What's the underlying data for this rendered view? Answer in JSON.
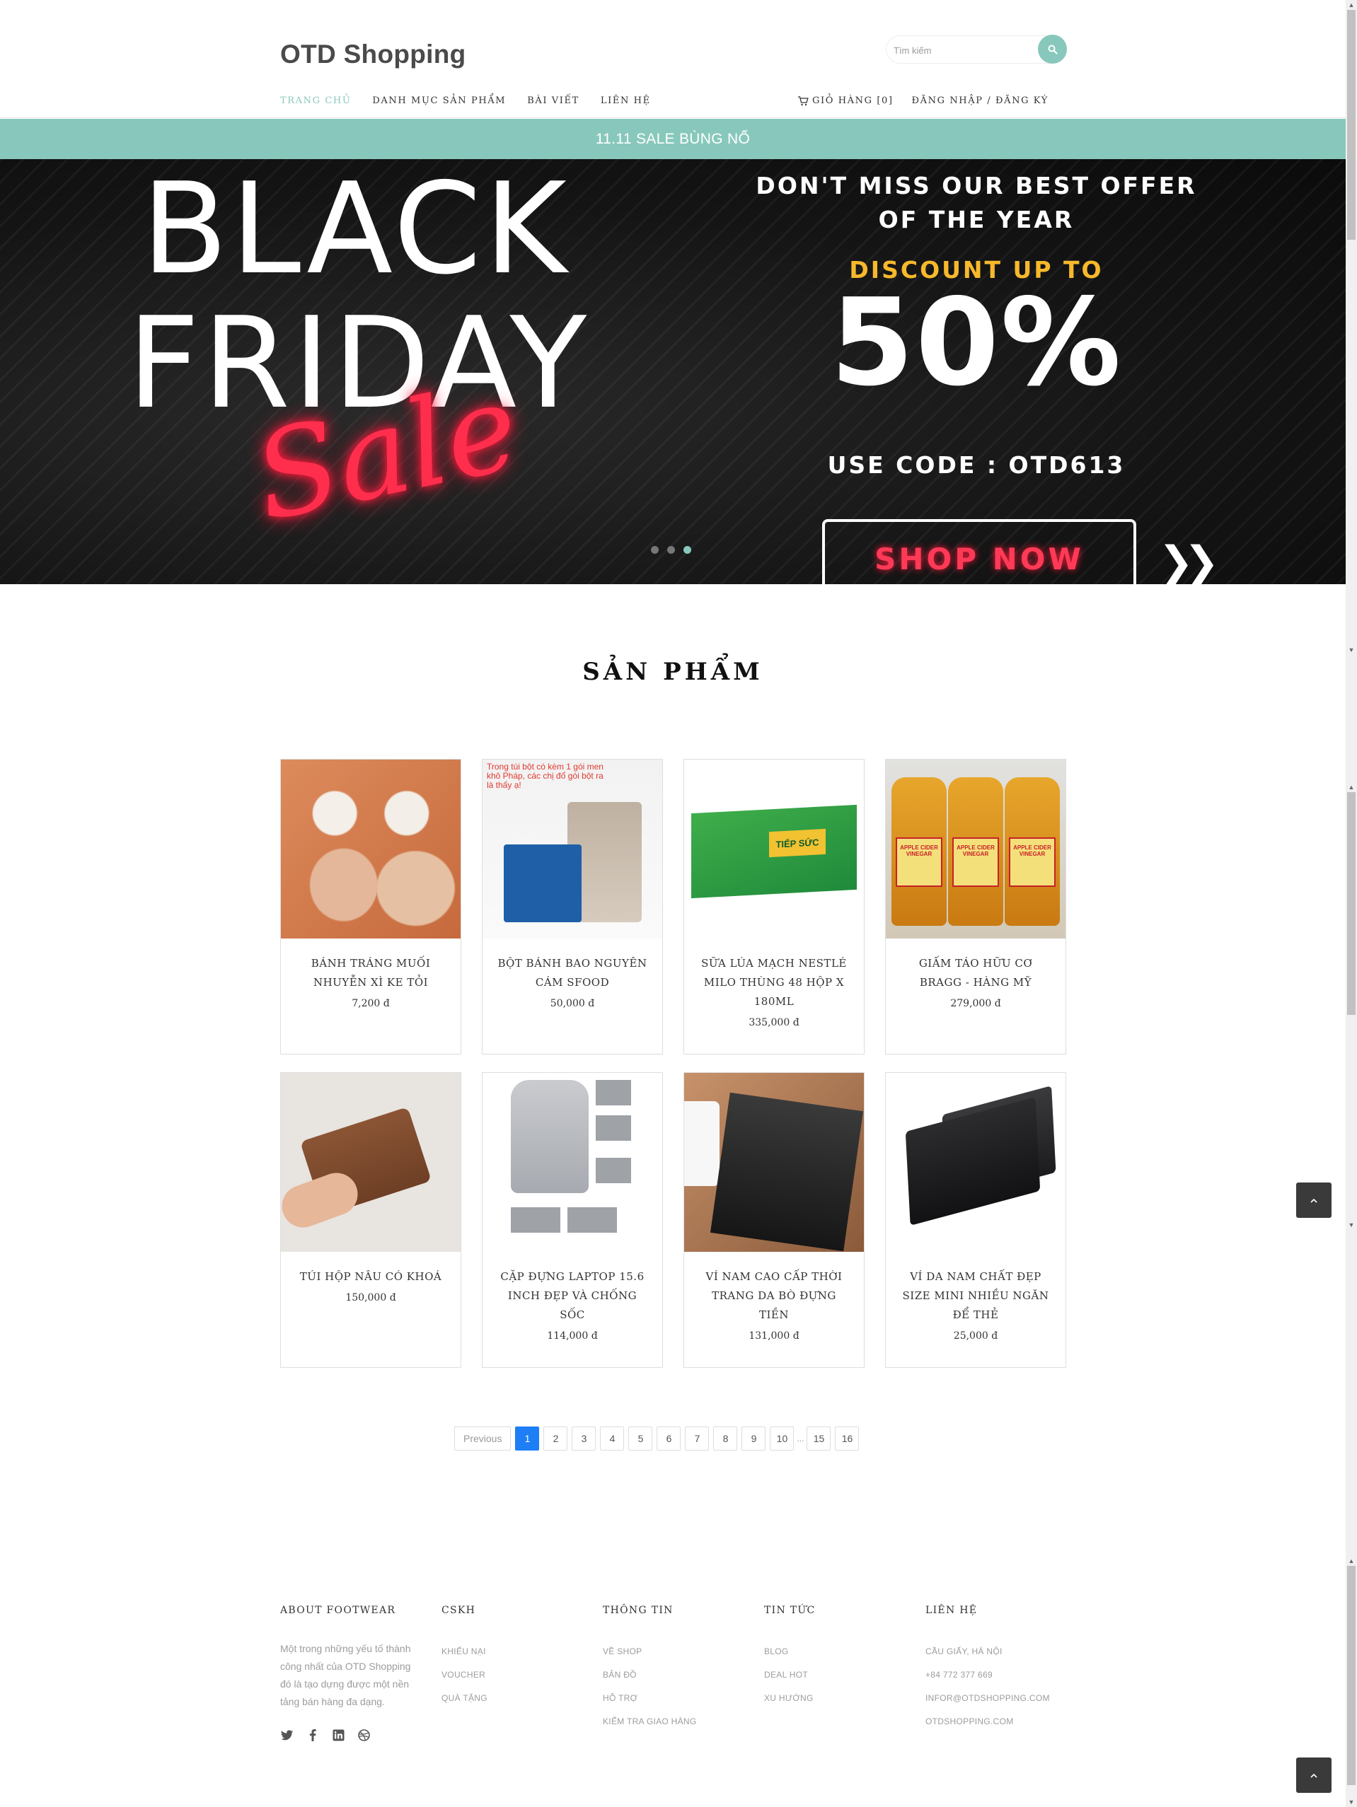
{
  "header": {
    "logo": "OTD Shopping",
    "search_placeholder": "Tìm kiếm",
    "nav": [
      "TRANG CHỦ",
      "DANH MỤC SẢN PHẨM",
      "BÀI VIẾT",
      "LIÊN HỆ"
    ],
    "cart_label": "GIỎ HÀNG [0]",
    "account_label": "ĐĂNG NHẬP / ĐĂNG KÝ"
  },
  "announcement": "11.11 SALE BÙNG NỔ",
  "banner": {
    "line1": "BLACK",
    "line2": "FRIDAY",
    "script": "Sale",
    "offer": "DON'T MISS OUR BEST OFFER OF THE YEAR",
    "discount": "DISCOUNT UP TO",
    "percent": "50%",
    "code": "USE CODE : OTD613",
    "cta": "SHOP NOW",
    "slides_total": 3,
    "slide_active": 3
  },
  "products_section": {
    "title": "SẢN PHẨM",
    "items": [
      {
        "name": "BÁNH TRÁNG MUỐI NHUYỄN XÌ KE TỎI",
        "price": "7,200 đ"
      },
      {
        "name": "BỘT BÁNH BAO NGUYÊN CÁM SFOOD",
        "price": "50,000 đ",
        "image_text": "Trong túi bột có kèm 1 gói men khô Pháp, các chị đổ gói bột ra là thấy ạ!"
      },
      {
        "name": "SỮA LÚA MẠCH NESTLÉ MILO THÙNG 48 HỘP X 180ML",
        "price": "335,000 đ",
        "image_text": "TIẾP SỨC"
      },
      {
        "name": "GIẤM TÁO HỮU CƠ BRAGG - HÀNG MỸ",
        "price": "279,000 đ",
        "image_text": "APPLE CIDER VINEGAR"
      },
      {
        "name": "TÚI HỘP NÂU CÓ KHOÁ",
        "price": "150,000 đ"
      },
      {
        "name": "CẶP ĐỰNG LAPTOP 15.6 INCH ĐẸP VÀ CHỐNG SỐC",
        "price": "114,000 đ"
      },
      {
        "name": "VÍ NAM CAO CẤP THỜI TRANG DA BÒ ĐỰNG TIỀN",
        "price": "131,000 đ"
      },
      {
        "name": "VÍ DA NAM CHẤT ĐẸP SIZE MINI NHIỀU NGĂN ĐỂ THẺ",
        "price": "25,000 đ"
      }
    ]
  },
  "pagination": {
    "previous": "Previous",
    "pages": [
      "1",
      "2",
      "3",
      "4",
      "5",
      "6",
      "7",
      "8",
      "9",
      "10"
    ],
    "ellipsis": "...",
    "tail": [
      "15",
      "16"
    ],
    "current": "1"
  },
  "footer": {
    "about": {
      "heading": "ABOUT FOOTWEAR",
      "text": "Một trong những yếu tố thành công nhất của OTD Shopping đó là tạo dựng được một nền tảng bán hàng đa dạng."
    },
    "cskh": {
      "heading": "CSKH",
      "links": [
        "KHIẾU NẠI",
        "VOUCHER",
        "QUÀ TẶNG"
      ]
    },
    "info": {
      "heading": "THÔNG TIN",
      "links": [
        "VỀ SHOP",
        "BẢN ĐỒ",
        "HỖ TRỢ",
        "KIỂM TRA GIAO HÀNG"
      ]
    },
    "news": {
      "heading": "TIN TỨC",
      "links": [
        "BLOG",
        "DEAL HOT",
        "XU HƯỚNG"
      ]
    },
    "contact": {
      "heading": "LIÊN HỆ",
      "links": [
        "CẦU GIẤY, HÀ NỘI",
        "+84 772 377 669",
        "INFOR@OTDSHOPPING.COM",
        "OTDSHOPPING.COM"
      ]
    },
    "social": [
      "twitter-icon",
      "facebook-icon",
      "linkedin-icon",
      "dribbble-icon"
    ]
  },
  "colors": {
    "accent": "#88c8bc",
    "pager_active": "#1e7ef5",
    "totop": "#3a3a3a"
  }
}
